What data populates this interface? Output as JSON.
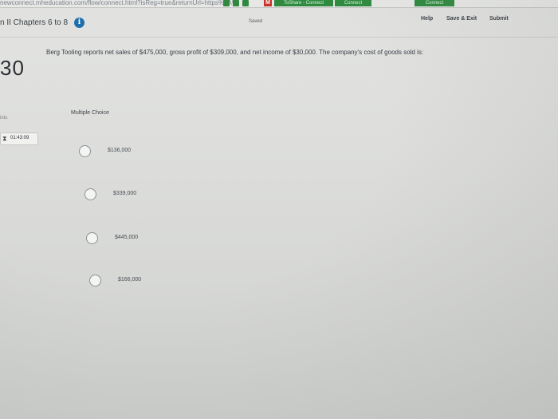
{
  "browser": {
    "url": "newconnect.mheducation.com/flow/connect.html?isReg=true&returnUrl=https%3A%",
    "tabs": [
      "ToShare - Connect",
      "Connect",
      "Connect"
    ],
    "badge": "M"
  },
  "header": {
    "title": "n II Chapters 6 to 8",
    "info_icon": "i",
    "saved": "Saved",
    "help": "Help",
    "save_exit": "Save & Exit",
    "submit": "Submit"
  },
  "sidebar": {
    "question_number": "30",
    "points_label": "ints",
    "timer_icon": "⧗",
    "timer": "01:43:09"
  },
  "question": {
    "text": "Berg Tooling reports net sales of $475,000, gross profit of $309,000, and net income of $30,000. The company's cost of goods sold is:",
    "type_label": "Multiple Choice",
    "options": [
      {
        "label": "$136,000"
      },
      {
        "label": "$339,000"
      },
      {
        "label": "$445,000"
      },
      {
        "label": "$166,000"
      }
    ]
  }
}
